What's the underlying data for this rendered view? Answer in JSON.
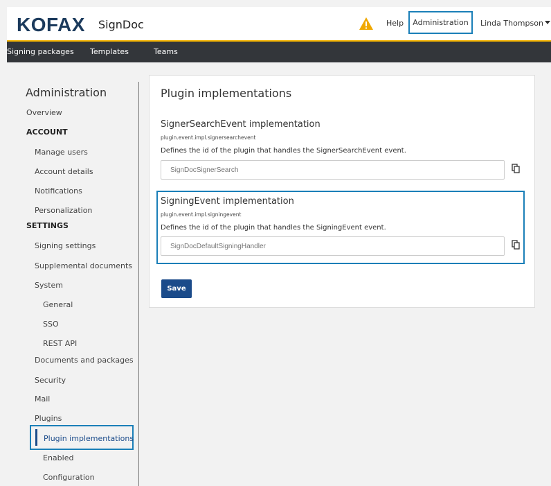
{
  "header": {
    "logo": "KOFAX",
    "product": "SignDoc",
    "warning_icon": "warning-icon",
    "help": "Help",
    "administration": "Administration",
    "user": "Linda Thompson",
    "accent_color": "#f5b400"
  },
  "nav": {
    "items": [
      "Signing packages",
      "Templates",
      "Teams"
    ]
  },
  "sidebar": {
    "title": "Administration",
    "overview": "Overview",
    "account_heading": "ACCOUNT",
    "manage_users": "Manage users",
    "account_details": "Account details",
    "notifications": "Notifications",
    "personalization": "Personalization",
    "settings_heading": "SETTINGS",
    "signing_settings": "Signing settings",
    "supplemental_documents": "Supplemental documents",
    "system": "System",
    "general": "General",
    "sso": "SSO",
    "rest_api": "REST API",
    "documents_and_packages": "Documents and packages",
    "security": "Security",
    "mail": "Mail",
    "plugins": "Plugins",
    "plugin_implementations": "Plugin implementations",
    "enabled": "Enabled",
    "configuration": "Configuration"
  },
  "main": {
    "title": "Plugin implementations",
    "sections": [
      {
        "title": "SignerSearchEvent implementation",
        "key": "plugin.event.impl.signersearchevent",
        "description": "Defines the id of the plugin that handles the SignerSearchEvent event.",
        "placeholder": "SignDocSignerSearch"
      },
      {
        "title": "SigningEvent implementation",
        "key": "plugin.event.impl.signingevent",
        "description": "Defines the id of the plugin that handles the SigningEvent event.",
        "placeholder": "SignDocDefaultSigningHandler"
      }
    ],
    "save": "Save",
    "highlight_color": "#1a7fb8",
    "primary_color": "#1b4b8a"
  }
}
